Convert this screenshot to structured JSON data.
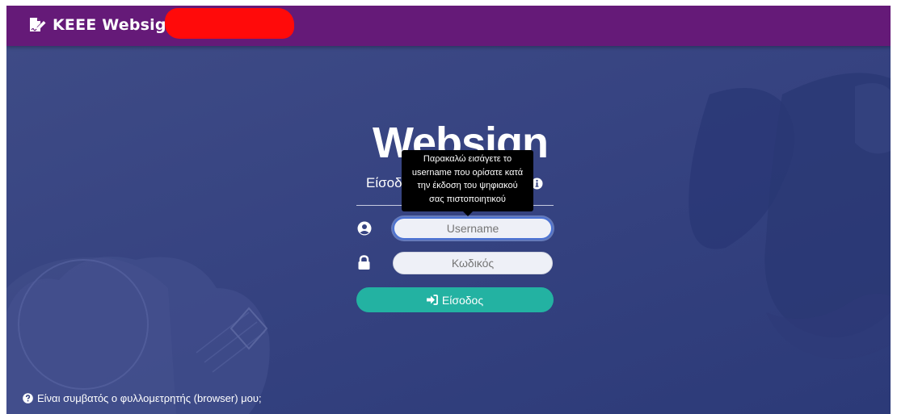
{
  "navbar": {
    "brand_name": "KEEE Websign",
    "brand_icon": "signature-icon"
  },
  "login": {
    "title": "Websign",
    "subtitle": "Είσοδ",
    "tooltip_lines": [
      "Παρακαλώ εισάγετε το",
      "username που ορίσατε κατά",
      "την έκδοση του ψηφιακού",
      "σας πιστοποιητικού"
    ],
    "username_placeholder": "Username",
    "password_placeholder": "Κωδικός",
    "submit_label": "Είσοδος"
  },
  "footer": {
    "browser_link": "Είναι συμβατός ο φυλλομετρητής (browser) μου;"
  },
  "colors": {
    "navbar": "#651a78",
    "background": "#364381",
    "button": "#23b2a2"
  }
}
